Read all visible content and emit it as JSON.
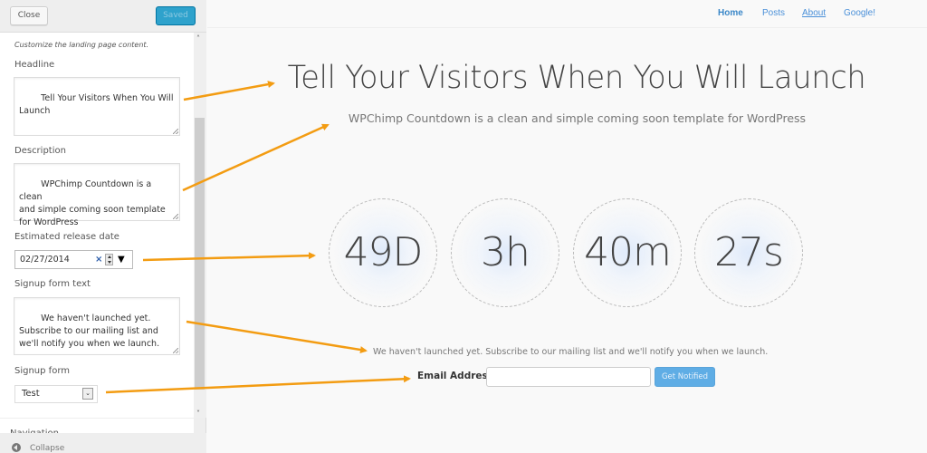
{
  "sidebar": {
    "close_label": "Close",
    "saved_label": "Saved",
    "intro": "Customize the landing page content.",
    "fields": {
      "headline": {
        "label": "Headline",
        "value": "Tell Your Visitors When You Will\nLaunch"
      },
      "description": {
        "label": "Description",
        "value": "WPChimp Countdown is a clean\nand simple coming soon template\nfor WordPress"
      },
      "release_date": {
        "label": "Estimated release date",
        "value": "02/27/2014",
        "clear_icon": "×",
        "dropdown_icon": "▼"
      },
      "signup_text": {
        "label": "Signup form text",
        "value": "We haven't launched yet.\nSubscribe to our mailing list and\nwe'll notify you when we launch."
      },
      "signup_form": {
        "label": "Signup form",
        "selected": "Test",
        "arrow_icon": "⌄"
      }
    },
    "next_section": "Navigation",
    "collapse_label": "Collapse",
    "scroll_up_icon": "˄",
    "scroll_down_icon": "˅"
  },
  "preview": {
    "nav": [
      {
        "label": "Home",
        "active": true
      },
      {
        "label": "Posts"
      },
      {
        "label": "About"
      },
      {
        "label": "Google!"
      }
    ],
    "headline": "Tell Your Visitors When You Will Launch",
    "description": "WPChimp Countdown is a clean and simple coming soon template for WordPress",
    "countdown": [
      {
        "value": "49D",
        "unit": "days"
      },
      {
        "value": "3h",
        "unit": "hours"
      },
      {
        "value": "40m",
        "unit": "minutes"
      },
      {
        "value": "27s",
        "unit": "seconds"
      }
    ],
    "signup_text": "We haven't launched yet. Subscribe to our mailing list and we'll notify you when we launch.",
    "email_label": "Email Address",
    "email_value": "",
    "notify_button": "Get Notified"
  },
  "colors": {
    "annotation_arrow": "#f39c12",
    "saved_button": "#2ea2cc",
    "notify_button": "#5fade5",
    "nav_link": "#4a90d9"
  }
}
